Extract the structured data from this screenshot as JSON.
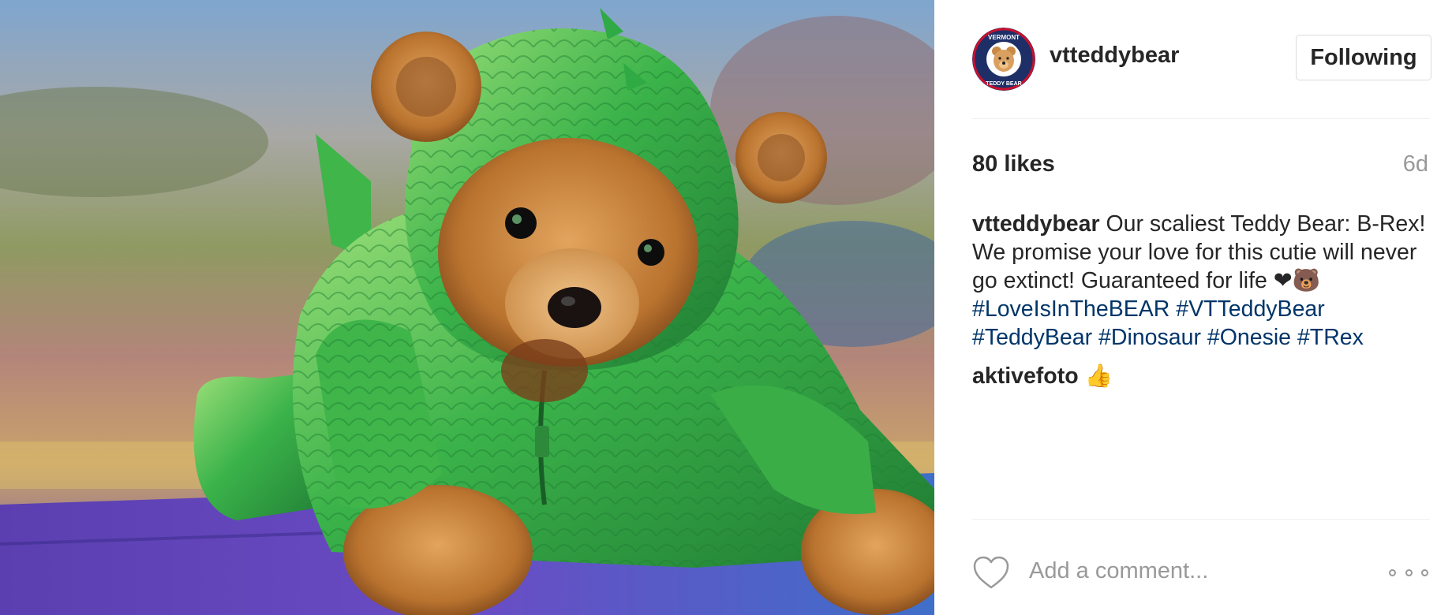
{
  "post": {
    "photo_alt": "teddy bear in green dinosaur onesie",
    "header": {
      "username": "vtteddybear",
      "avatar_text_top": "VERMONT",
      "avatar_text_bottom": "TEDDY BEAR",
      "follow_label": "Following"
    },
    "likes": "80 likes",
    "age": "6d",
    "caption": {
      "username": "vtteddybear",
      "text": "Our scaliest Teddy Bear: B-Rex! We promise your love for this cutie will never go extinct! Guaranteed for life ❤🐻",
      "hashtags": [
        "#LoveIsInTheBEAR",
        "#VTTeddyBear",
        "#TeddyBear",
        "#Dinosaur",
        "#Onesie",
        "#TRex"
      ]
    },
    "comment": {
      "username": "aktivefoto",
      "text": "👍"
    },
    "add_comment_placeholder": "Add a comment...",
    "colors": {
      "hashtag": "#003569",
      "muted": "#999999",
      "text": "#262626"
    }
  }
}
